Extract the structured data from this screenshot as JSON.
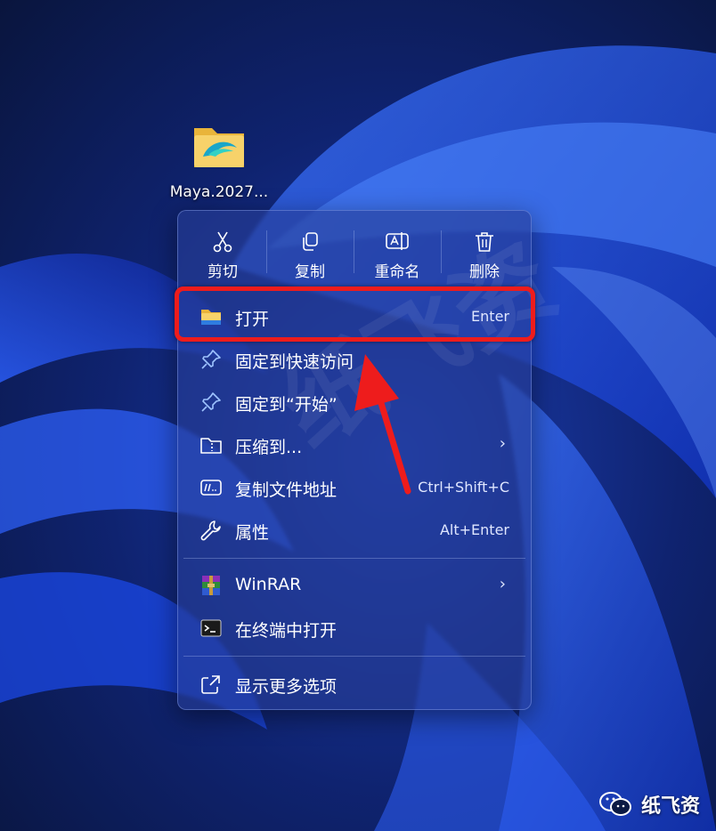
{
  "desktop": {
    "icon_label": "Maya.2027...",
    "icon": "folder-icon"
  },
  "context_menu": {
    "quick_actions": [
      {
        "label": "剪切",
        "icon": "scissors-icon"
      },
      {
        "label": "复制",
        "icon": "copy-icon"
      },
      {
        "label": "重命名",
        "icon": "rename-icon"
      },
      {
        "label": "删除",
        "icon": "trash-icon"
      }
    ],
    "items": [
      {
        "label": "打开",
        "shortcut": "Enter",
        "icon": "folder-icon"
      },
      {
        "label": "固定到快速访问",
        "shortcut": "",
        "icon": "pin-icon"
      },
      {
        "label": "固定到“开始”",
        "shortcut": "",
        "icon": "pin-icon"
      },
      {
        "label": "压缩到...",
        "shortcut": "",
        "icon": "zip-folder-icon",
        "submenu": true
      },
      {
        "label": "复制文件地址",
        "shortcut": "Ctrl+Shift+C",
        "icon": "path-icon"
      },
      {
        "label": "属性",
        "shortcut": "Alt+Enter",
        "icon": "wrench-icon"
      },
      {
        "label": "WinRAR",
        "shortcut": "",
        "icon": "winrar-icon",
        "submenu": true
      },
      {
        "label": "在终端中打开",
        "shortcut": "",
        "icon": "terminal-icon"
      },
      {
        "label": "显示更多选项",
        "shortcut": "",
        "icon": "more-options-icon"
      }
    ]
  },
  "annotation": {
    "highlight_color": "#ee1c1c"
  },
  "watermark": {
    "center_text": "纸飞资",
    "brand_text": "纸飞资",
    "brand_icon": "wechat-icon"
  },
  "colors": {
    "wallpaper_dark": "#0b1a44",
    "wallpaper_bloom": "#1f4fe0",
    "menu_bg": "#263e96"
  }
}
